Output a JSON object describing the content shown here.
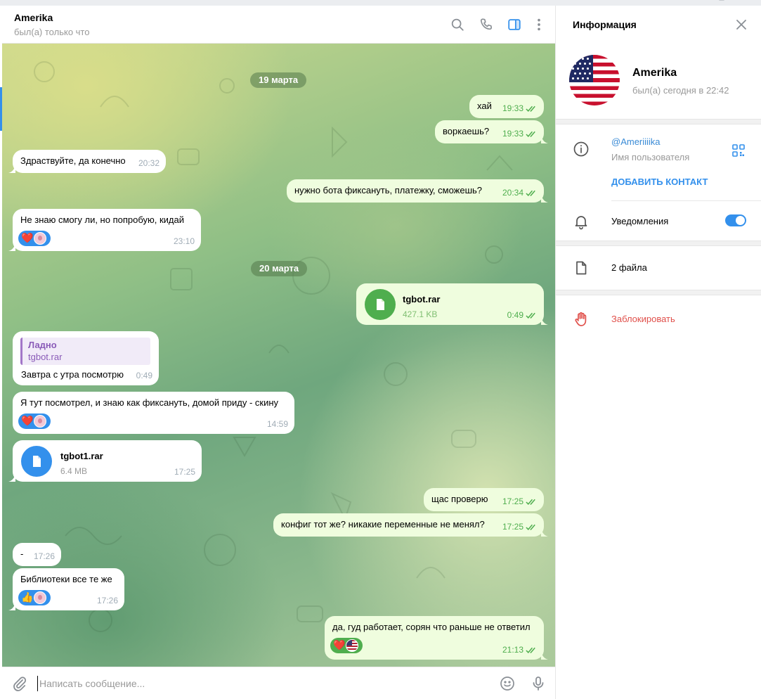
{
  "chat": {
    "title": "Amerika",
    "status": "был(а) только что",
    "header_icons": [
      "search-icon",
      "phone-icon",
      "sidebar-toggle-icon",
      "more-vertical-icon"
    ]
  },
  "colors": {
    "accent": "#3390ec",
    "out_bubble": "#effdde",
    "out_meta": "#4fae4e",
    "in_bubble": "#ffffff",
    "danger": "#e0504b",
    "reply_accent": "#a276c8"
  },
  "dates": [
    "19 марта",
    "20 марта"
  ],
  "messages": [
    {
      "dir": "out",
      "text": "хай",
      "time": "19:33",
      "read": true
    },
    {
      "dir": "out",
      "text": "воркаешь?",
      "time": "19:33",
      "read": true
    },
    {
      "dir": "in",
      "text": "Здраствуйте, да конечно",
      "time": "20:32"
    },
    {
      "dir": "out",
      "text": "нужно бота фиксануть, платежку, сможешь?",
      "time": "20:34",
      "read": true
    },
    {
      "dir": "in",
      "text": "Не знаю смогу ли, но попробую, кидай",
      "time": "23:10",
      "reactions": [
        "❤️",
        "avatar"
      ]
    },
    {
      "dir": "out",
      "file_name": "tgbot.rar",
      "file_size": "427.1 KB",
      "time": "0:49",
      "read": true
    },
    {
      "dir": "in",
      "reply_author": "Ладно",
      "reply_text": "tgbot.rar",
      "text": "Завтра с утра посмотрю",
      "time": "0:49"
    },
    {
      "dir": "in",
      "text": "Я тут посмотрел, и знаю как фиксануть, домой приду - скину",
      "time": "14:59",
      "reactions": [
        "❤️",
        "avatar"
      ]
    },
    {
      "dir": "in",
      "file_name": "tgbot1.rar",
      "file_size": "6.4 MB",
      "time": "17:25"
    },
    {
      "dir": "out",
      "text": "щас проверю",
      "time": "17:25",
      "read": true
    },
    {
      "dir": "out",
      "text": "конфиг тот же? никакие переменные не менял?",
      "time": "17:25",
      "read": true
    },
    {
      "dir": "in",
      "text": "-",
      "time": "17:26"
    },
    {
      "dir": "in",
      "text": "Библиотеки все те же",
      "time": "17:26",
      "reactions": [
        "👍",
        "avatar"
      ]
    },
    {
      "dir": "out",
      "text": "да, гуд работает, сорян что раньше не ответил",
      "time": "21:13",
      "read": true,
      "reactions": [
        "❤️",
        "us-flag"
      ]
    }
  ],
  "composer": {
    "placeholder": "Написать сообщение...",
    "icons": [
      "attach-icon",
      "emoji-icon",
      "microphone-icon"
    ]
  },
  "info_panel": {
    "title": "Информация",
    "name": "Amerika",
    "last_seen": "был(а) сегодня в 22:42",
    "username": "@Ameriiiika",
    "username_caption": "Имя пользователя",
    "add_contact": "ДОБАВИТЬ КОНТАКТ",
    "notifications_label": "Уведомления",
    "notifications_on": true,
    "files_label": "2 файла",
    "block_label": "Заблокировать"
  }
}
